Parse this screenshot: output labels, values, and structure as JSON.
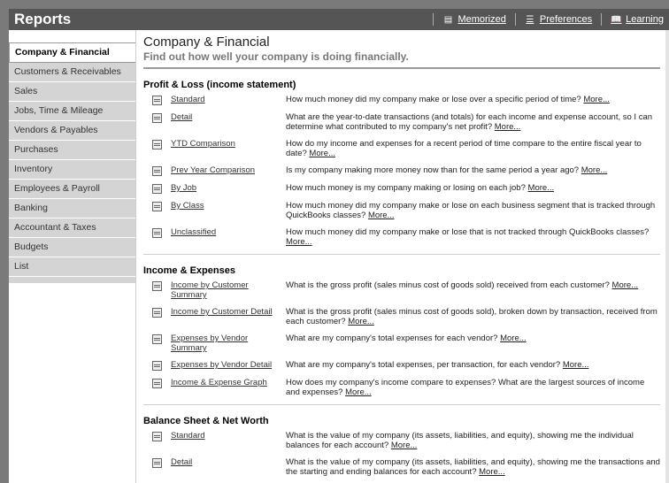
{
  "window": {
    "title": "Reports"
  },
  "toolbar": {
    "memorized": "Memorized",
    "preferences": "Preferences",
    "learning": "Learning"
  },
  "sidebar": {
    "items": [
      {
        "label": "Company & Financial"
      },
      {
        "label": "Customers & Receivables"
      },
      {
        "label": "Sales"
      },
      {
        "label": "Jobs, Time & Mileage"
      },
      {
        "label": "Vendors & Payables"
      },
      {
        "label": "Purchases"
      },
      {
        "label": "Inventory"
      },
      {
        "label": "Employees & Payroll"
      },
      {
        "label": "Banking"
      },
      {
        "label": "Accountant & Taxes"
      },
      {
        "label": "Budgets"
      },
      {
        "label": "List"
      }
    ]
  },
  "main": {
    "title": "Company & Financial",
    "subtitle": "Find out how well your company is doing financially.",
    "more_label": "More...",
    "sections": [
      {
        "title": "Profit & Loss (income statement)",
        "reports": [
          {
            "name": "Standard",
            "desc": "How much money did my company make or lose over a specific period of time?"
          },
          {
            "name": "Detail",
            "desc": "What are the year-to-date transactions (and totals) for each income and expense account, so I can determine what contributed to my company's net profit?"
          },
          {
            "name": "YTD Comparison",
            "desc": "How do my income and expenses for a recent period of time compare to the entire fiscal year to date?"
          },
          {
            "name": "Prev Year Comparison",
            "desc": "Is my company making more money now than for the same period a year ago?"
          },
          {
            "name": "By Job",
            "desc": "How much money is my company making or losing on each job?"
          },
          {
            "name": "By Class",
            "desc": "How much money did my company make or lose on each business segment that is tracked through QuickBooks classes?"
          },
          {
            "name": "Unclassified",
            "desc": "How much money did my company make or lose that is not tracked through QuickBooks classes?"
          }
        ]
      },
      {
        "title": "Income & Expenses",
        "reports": [
          {
            "name": "Income by Customer Summary",
            "desc": "What is the gross profit (sales minus cost of goods sold) received from each customer?"
          },
          {
            "name": "Income by Customer Detail",
            "desc": "What is the gross profit (sales minus cost of goods sold), broken down by transaction, received from each customer?"
          },
          {
            "name": "Expenses by Vendor Summary",
            "desc": "What are my company's total expenses for each vendor?"
          },
          {
            "name": "Expenses by Vendor Detail",
            "desc": "What are my company's total expenses, per transaction, for each vendor?"
          },
          {
            "name": "Income & Expense Graph",
            "desc": "How does my company's income compare to expenses? What are the largest sources of income and expenses?"
          }
        ]
      },
      {
        "title": "Balance Sheet & Net Worth",
        "reports": [
          {
            "name": "Standard",
            "desc": "What is the value of my company (its assets, liabilities, and equity), showing me the individual balances for each account?"
          },
          {
            "name": "Detail",
            "desc": "What is the value of my company (its assets, liabilities, and equity), showing me the transactions and the starting and ending balances for each account?"
          }
        ]
      }
    ]
  },
  "colors": {
    "titlebar": "#555555",
    "sidebar_item": "#d4d4d4",
    "background": "#7a7a7a"
  },
  "icons": {
    "memorized": "memorized-icon",
    "preferences": "preferences-icon",
    "learning": "book-icon",
    "report": "report-icon"
  }
}
